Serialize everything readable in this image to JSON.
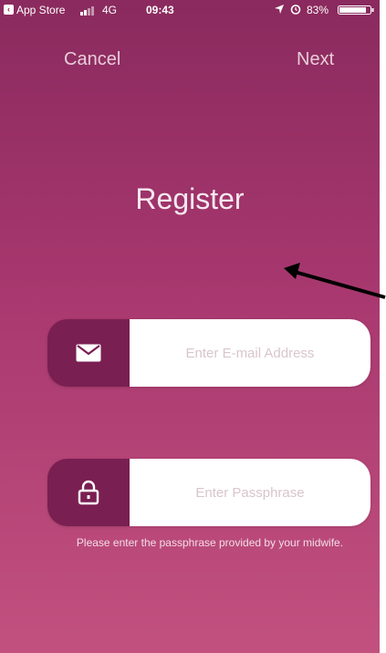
{
  "status_bar": {
    "back_app": "App Store",
    "network": "4G",
    "time": "09:43",
    "battery": "83%"
  },
  "nav": {
    "cancel_label": "Cancel",
    "next_label": "Next"
  },
  "page": {
    "title": "Register"
  },
  "email_field": {
    "placeholder": "Enter E-mail Address",
    "value": "",
    "icon": "envelope-icon"
  },
  "passphrase_field": {
    "placeholder": "Enter Passphrase",
    "value": "",
    "icon": "lock-icon"
  },
  "hint": {
    "text": "Please enter the passphrase provided by your midwife."
  },
  "colors": {
    "background_top": "#8a2a5e",
    "background_bottom": "#c2517f",
    "icon_panel": "#7a1f52",
    "input_bg": "#ffffff"
  }
}
